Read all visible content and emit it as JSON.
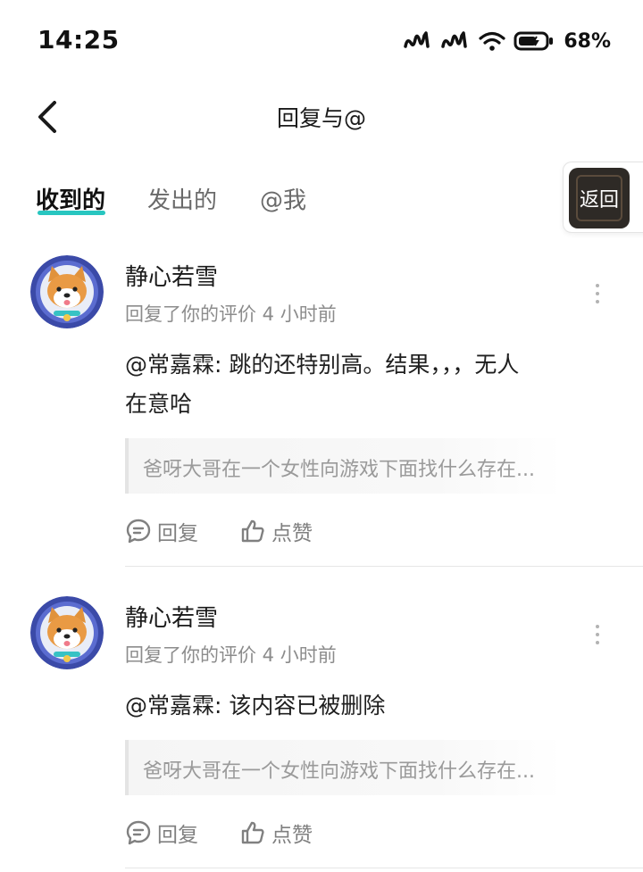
{
  "status_bar": {
    "time": "14:25",
    "battery": "68%",
    "battery_level": 0.68
  },
  "header": {
    "title": "回复与@"
  },
  "tabs": [
    {
      "label": "收到的",
      "active": true
    },
    {
      "label": "发出的",
      "active": false
    },
    {
      "label": "@我",
      "active": false
    }
  ],
  "float_return": {
    "label": "返回"
  },
  "comments": [
    {
      "username": "静心若雪",
      "meta": "回复了你的评价 4 小时前",
      "body_line1": "@常嘉霖: 跳的还特别高。结果，，，无人",
      "body_line2": "在意哈",
      "quote": "爸呀大哥在一个女性向游戏下面找什么存在...",
      "reply_label": "回复",
      "like_label": "点赞"
    },
    {
      "username": "静心若雪",
      "meta": "回复了你的评价 4 小时前",
      "body_line1": "@常嘉霖: 该内容已被删除",
      "quote": "爸呀大哥在一个女性向游戏下面找什么存在...",
      "reply_label": "回复",
      "like_label": "点赞"
    }
  ],
  "colors": {
    "accent": "#28c6c0",
    "muted_text": "#8c8c8c",
    "divider": "#e6e6e6"
  }
}
